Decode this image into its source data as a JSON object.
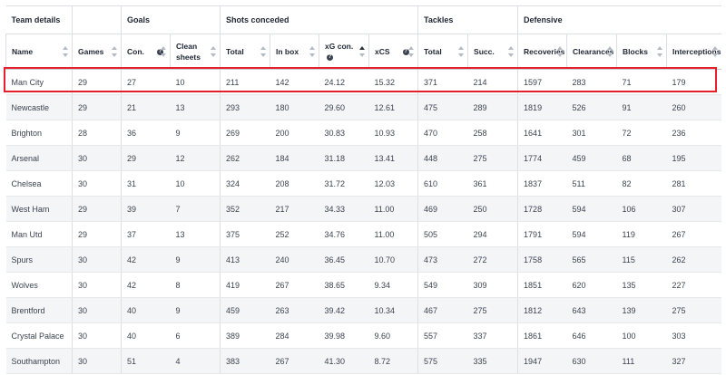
{
  "groups": [
    {
      "label": "Team details",
      "span": 1
    },
    {
      "label": "",
      "span": 1
    },
    {
      "label": "Goals",
      "span": 2
    },
    {
      "label": "Shots conceded",
      "span": 4
    },
    {
      "label": "Tackles",
      "span": 2
    },
    {
      "label": "Defensive",
      "span": 4
    }
  ],
  "columns": [
    {
      "label": "Name",
      "sort": "none",
      "info": false
    },
    {
      "label": "Games",
      "sort": "none",
      "info": false
    },
    {
      "label": "Con.",
      "sort": "none",
      "info": true
    },
    {
      "label": "Clean sheets",
      "sort": "none",
      "info": false
    },
    {
      "label": "Total",
      "sort": "none",
      "info": false
    },
    {
      "label": "In box",
      "sort": "none",
      "info": false
    },
    {
      "label": "xG con.",
      "sort": "desc",
      "info": true
    },
    {
      "label": "xCS",
      "sort": "none",
      "info": true
    },
    {
      "label": "Total",
      "sort": "none",
      "info": false
    },
    {
      "label": "Succ.",
      "sort": "none",
      "info": false
    },
    {
      "label": "Recoveries",
      "sort": "none",
      "info": false
    },
    {
      "label": "Clearances",
      "sort": "none",
      "info": false
    },
    {
      "label": "Blocks",
      "sort": "none",
      "info": false
    },
    {
      "label": "Interceptions",
      "sort": "none",
      "info": false
    }
  ],
  "rows": [
    [
      "Man City",
      "29",
      "27",
      "10",
      "211",
      "142",
      "24.12",
      "15.32",
      "371",
      "214",
      "1597",
      "283",
      "71",
      "179"
    ],
    [
      "Newcastle",
      "29",
      "21",
      "13",
      "293",
      "180",
      "29.60",
      "12.61",
      "475",
      "289",
      "1819",
      "526",
      "91",
      "260"
    ],
    [
      "Brighton",
      "28",
      "36",
      "9",
      "269",
      "200",
      "30.83",
      "10.93",
      "470",
      "258",
      "1641",
      "301",
      "72",
      "236"
    ],
    [
      "Arsenal",
      "30",
      "29",
      "12",
      "262",
      "184",
      "31.18",
      "13.41",
      "448",
      "275",
      "1774",
      "459",
      "68",
      "195"
    ],
    [
      "Chelsea",
      "30",
      "31",
      "10",
      "324",
      "208",
      "31.72",
      "12.03",
      "610",
      "361",
      "1837",
      "511",
      "82",
      "281"
    ],
    [
      "West Ham",
      "29",
      "39",
      "7",
      "352",
      "217",
      "34.33",
      "11.00",
      "469",
      "250",
      "1728",
      "594",
      "106",
      "307"
    ],
    [
      "Man Utd",
      "29",
      "37",
      "13",
      "375",
      "252",
      "34.76",
      "11.00",
      "505",
      "294",
      "1791",
      "594",
      "119",
      "267"
    ],
    [
      "Spurs",
      "30",
      "42",
      "9",
      "413",
      "240",
      "36.45",
      "10.70",
      "473",
      "272",
      "1758",
      "565",
      "115",
      "262"
    ],
    [
      "Wolves",
      "30",
      "42",
      "8",
      "419",
      "267",
      "38.65",
      "9.34",
      "549",
      "309",
      "1851",
      "620",
      "135",
      "227"
    ],
    [
      "Brentford",
      "30",
      "40",
      "9",
      "459",
      "263",
      "39.42",
      "10.34",
      "467",
      "275",
      "1812",
      "643",
      "139",
      "275"
    ],
    [
      "Crystal Palace",
      "30",
      "40",
      "6",
      "389",
      "284",
      "39.98",
      "9.60",
      "557",
      "337",
      "1861",
      "646",
      "100",
      "303"
    ],
    [
      "Southampton",
      "30",
      "51",
      "4",
      "383",
      "267",
      "41.30",
      "8.72",
      "575",
      "335",
      "1947",
      "630",
      "111",
      "327"
    ]
  ],
  "highlight_row": 0,
  "colors": {
    "highlight": "#e5202a",
    "stripe": "#f4f5f7",
    "border": "#dcdfe4"
  }
}
